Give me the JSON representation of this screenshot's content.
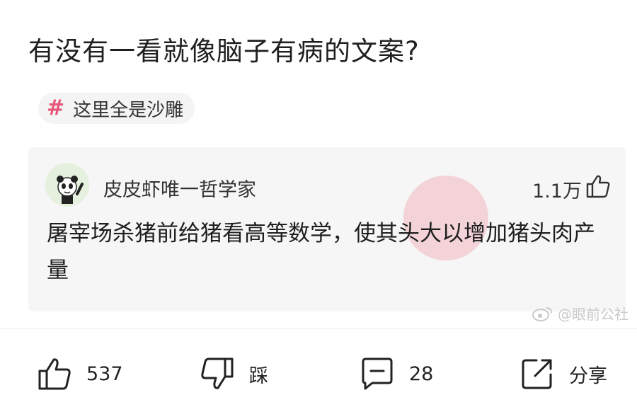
{
  "question": {
    "title": "有没有一看就像脑子有病的文案?"
  },
  "topic": {
    "label": "这里全是沙雕"
  },
  "answer": {
    "author": "皮皮虾唯一哲学家",
    "likes": "1.1万",
    "text": "屠宰场杀猪前给猪看高等数学，使其头大以增加猪头肉产量"
  },
  "watermark": {
    "text": "@眼前公社"
  },
  "actions": {
    "like_count": "537",
    "dislike_label": "踩",
    "comment_count": "28",
    "share_label": "分享"
  },
  "colors": {
    "accent": "#e8567a",
    "card_bg": "#f6f6f6"
  }
}
